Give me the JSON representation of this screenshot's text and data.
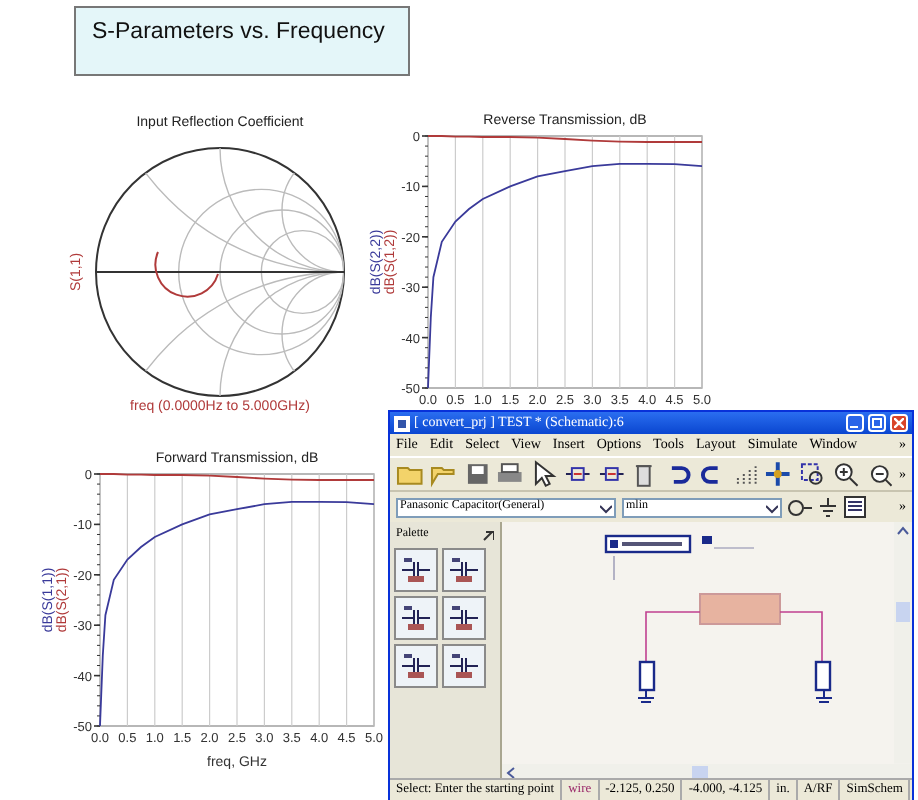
{
  "title_box": {
    "text": "S-Parameters vs. Frequency"
  },
  "smith_chart": {
    "title": "Input Reflection Coefficient",
    "trace_label": "S(1,1)",
    "sweep_label": "freq (0.0000Hz to 5.000GHz)"
  },
  "plots": [
    {
      "chart_data": {
        "type": "line",
        "grid": true,
        "title": "Reverse Transmission, dB",
        "x": [
          0,
          0.05,
          0.1,
          0.25,
          0.5,
          0.75,
          1,
          1.5,
          2,
          2.5,
          3,
          3.5,
          4,
          4.5,
          5
        ],
        "xlim": [
          0,
          5
        ],
        "ylim": [
          -50,
          0
        ],
        "xticks": [
          {
            "value": 0,
            "label": "0.0"
          },
          {
            "value": 0.5,
            "label": "0.5"
          },
          {
            "value": 1,
            "label": "1.0"
          },
          {
            "value": 1.5,
            "label": "1.5"
          },
          {
            "value": 2,
            "label": "2.0"
          },
          {
            "value": 2.5,
            "label": "2.5"
          },
          {
            "value": 3,
            "label": "3.0"
          },
          {
            "value": 3.5,
            "label": "3.5"
          },
          {
            "value": 4,
            "label": "4.0"
          },
          {
            "value": 4.5,
            "label": "4.5"
          },
          {
            "value": 5,
            "label": "5.0"
          }
        ],
        "yticks": [
          0,
          -10,
          -20,
          -30,
          -40,
          -50
        ],
        "series": [
          {
            "name": "dB(S(2,2))",
            "color": "#3a3a9a",
            "values": [
              -50,
              -36,
              -28,
              -21,
              -17,
              -14.5,
              -12.5,
              -10,
              -8,
              -7,
              -6,
              -5.5,
              -5.5,
              -5.6,
              -6
            ]
          },
          {
            "name": "dB(S(1,2))",
            "color": "#b03a3a",
            "values": [
              0,
              0,
              0,
              0,
              -0.1,
              -0.1,
              -0.2,
              -0.2,
              -0.3,
              -0.6,
              -0.9,
              -1.1,
              -1.2,
              -1.2,
              -1.2
            ]
          }
        ]
      }
    },
    {
      "chart_data": {
        "type": "line",
        "grid": true,
        "title": "Forward Transmission, dB",
        "xlabel": "freq, GHz",
        "x": [
          0,
          0.05,
          0.1,
          0.25,
          0.5,
          0.75,
          1,
          1.5,
          2,
          2.5,
          3,
          3.5,
          4,
          4.5,
          5
        ],
        "xlim": [
          0,
          5
        ],
        "ylim": [
          -50,
          0
        ],
        "xticks": [
          {
            "value": 0,
            "label": "0.0"
          },
          {
            "value": 0.5,
            "label": "0.5"
          },
          {
            "value": 1,
            "label": "1.0"
          },
          {
            "value": 1.5,
            "label": "1.5"
          },
          {
            "value": 2,
            "label": "2.0"
          },
          {
            "value": 2.5,
            "label": "2.5"
          },
          {
            "value": 3,
            "label": "3.0"
          },
          {
            "value": 3.5,
            "label": "3.5"
          },
          {
            "value": 4,
            "label": "4.0"
          },
          {
            "value": 4.5,
            "label": "4.5"
          },
          {
            "value": 5,
            "label": "5.0"
          }
        ],
        "yticks": [
          0,
          -10,
          -20,
          -30,
          -40,
          -50
        ],
        "series": [
          {
            "name": "dB(S(1,1))",
            "color": "#3a3a9a",
            "values": [
              -50,
              -36,
              -28,
              -21,
              -17,
              -14.5,
              -12.5,
              -10,
              -8,
              -7,
              -6,
              -5.5,
              -5.5,
              -5.6,
              -6
            ]
          },
          {
            "name": "dB(S(2,1))",
            "color": "#b03a3a",
            "values": [
              0,
              0,
              0,
              0,
              -0.1,
              -0.1,
              -0.2,
              -0.2,
              -0.3,
              -0.6,
              -0.9,
              -1.1,
              -1.2,
              -1.2,
              -1.2
            ]
          }
        ]
      }
    }
  ],
  "schematic_window": {
    "title": "[ convert_prj ] TEST * (Schematic):6",
    "menu": [
      "File",
      "Edit",
      "Select",
      "View",
      "Insert",
      "Options",
      "Tools",
      "Layout",
      "Simulate",
      "Window"
    ],
    "menu_more": "»",
    "toolbar_more": "»",
    "library_more": "»",
    "library_combo": "Panasonic Capacitor(General)",
    "component_combo": "mlin",
    "palette": {
      "title": "Palette"
    },
    "status_bar": [
      {
        "text": "Select: Enter the starting point",
        "color": "#000000"
      },
      {
        "text": "wire",
        "color": "#9a2a6a"
      },
      {
        "text": "-2.125, 0.250",
        "color": "#000000"
      },
      {
        "text": "-4.000, -4.125",
        "color": "#000000"
      },
      {
        "text": "in.",
        "color": "#000000"
      },
      {
        "text": "A/RF",
        "color": "#000000"
      },
      {
        "text": "SimSchem",
        "color": "#000000"
      }
    ]
  }
}
